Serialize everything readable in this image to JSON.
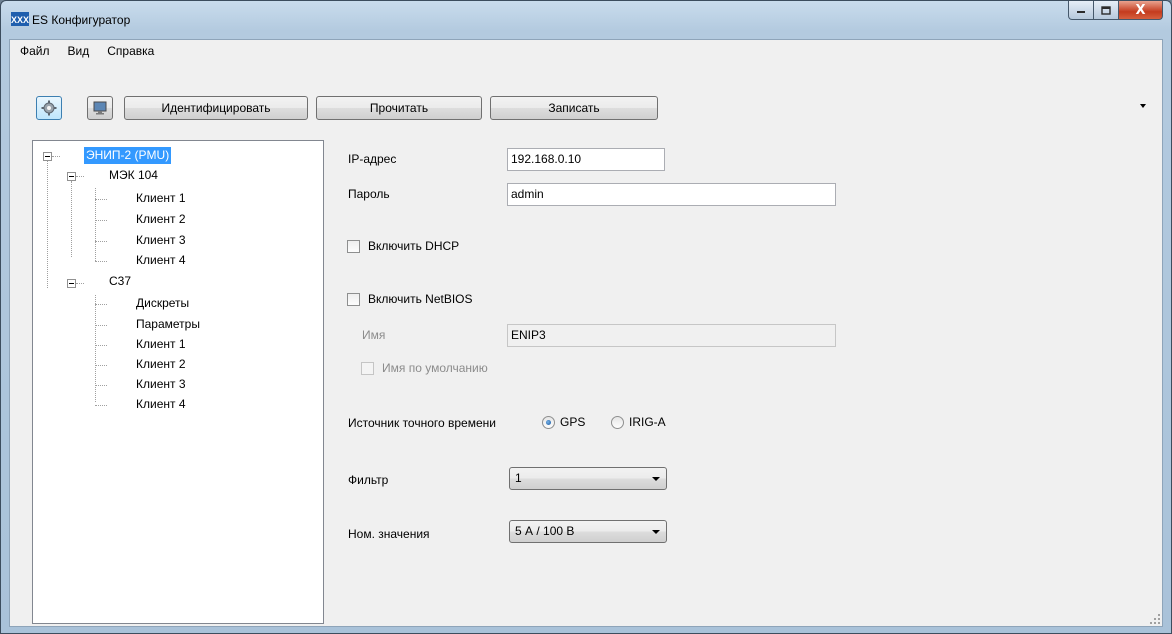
{
  "window": {
    "title": "ES Конфигуратор",
    "logo_text": "XXX",
    "close_glyph": "X"
  },
  "menu": [
    "Файл",
    "Вид",
    "Справка"
  ],
  "toolbar": {
    "settings_icon": "gear-icon",
    "monitor_icon": "monitor-icon",
    "identify_label": "Идентифицировать",
    "read_label": "Прочитать",
    "write_label": "Записать"
  },
  "tree": {
    "root": "ЭНИП-2 (PMU)",
    "iec104": {
      "label": "МЭК 104",
      "children": [
        "Клиент 1",
        "Клиент 2",
        "Клиент 3",
        "Клиент 4"
      ]
    },
    "c37": {
      "label": "C37",
      "children": [
        "Дискреты",
        "Параметры",
        "Клиент 1",
        "Клиент 2",
        "Клиент 3",
        "Клиент 4"
      ]
    }
  },
  "form": {
    "ip_label": "IP-адрес",
    "ip_value": "192.168.0.10",
    "password_label": "Пароль",
    "password_value": "admin",
    "dhcp_label": "Включить DHCP",
    "dhcp_checked": false,
    "netbios_label": "Включить NetBIOS",
    "netbios_checked": false,
    "name_label": "Имя",
    "name_value": "ENIP3",
    "default_name_label": "Имя по умолчанию",
    "default_name_checked": false,
    "time_source_label": "Источник точного времени",
    "time_source_options": [
      "GPS",
      "IRIG-A"
    ],
    "time_source_selected": "GPS",
    "filter_label": "Фильтр",
    "filter_value": "1",
    "nominal_label": "Ном. значения",
    "nominal_value": "5 А / 100 В"
  },
  "colors": {
    "selection": "#3399ff",
    "close_button": "#c43b1e"
  }
}
